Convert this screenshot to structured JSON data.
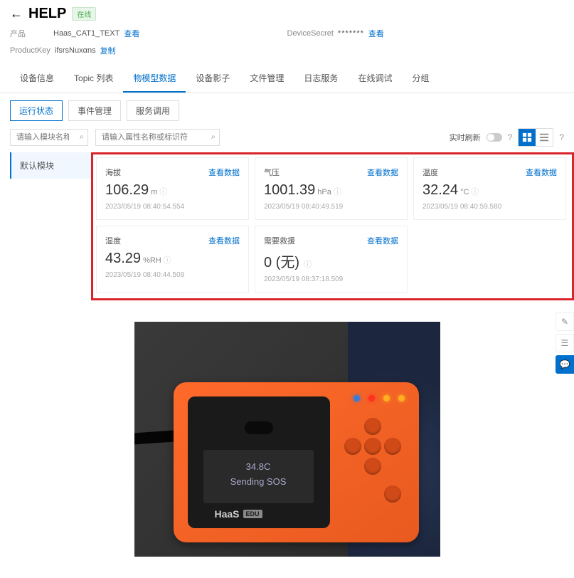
{
  "header": {
    "title": "HELP",
    "status": "在线",
    "product_label": "产品",
    "product_value": "Haas_CAT1_TEXT",
    "product_link": "查看",
    "device_secret_label": "DeviceSecret",
    "device_secret_value": "*******",
    "device_secret_link": "查看",
    "productkey_label": "ProductKey",
    "productkey_value": "ifsrsNuxαns",
    "productkey_link": "复制"
  },
  "tabs": [
    "设备信息",
    "Topic 列表",
    "物模型数据",
    "设备影子",
    "文件管理",
    "日志服务",
    "在线调试",
    "分组"
  ],
  "active_tab": "物模型数据",
  "sub_tabs": [
    "运行状态",
    "事件管理",
    "服务调用"
  ],
  "active_sub_tab": "运行状态",
  "search": {
    "module_placeholder": "请输入模块名称",
    "property_placeholder": "请输入属性名称或标识符"
  },
  "controls": {
    "refresh_label": "实时刷新"
  },
  "sidebar": {
    "items": [
      "默认模块"
    ],
    "active": "默认模块"
  },
  "view_link_label": "查看数据",
  "cards": [
    {
      "name": "海拔",
      "value": "106.29",
      "unit": "m",
      "time": "2023/05/19 08:40:54.554"
    },
    {
      "name": "气压",
      "value": "1001.39",
      "unit": "hPa",
      "time": "2023/05/19 08:40:49.519"
    },
    {
      "name": "温度",
      "value": "32.24",
      "unit": "°C",
      "time": "2023/05/19 08:40:59.580"
    },
    {
      "name": "湿度",
      "value": "43.29",
      "unit": "%RH",
      "time": "2023/05/19 08:40:44.509"
    },
    {
      "name": "需要救援",
      "value": "0 (无)",
      "unit": "",
      "time": "2023/05/19 08:37:18.509"
    }
  ],
  "device_display": {
    "line1": "34.8C",
    "line2": "Sending SOS",
    "brand": "HaaS",
    "edition": "EDU"
  }
}
